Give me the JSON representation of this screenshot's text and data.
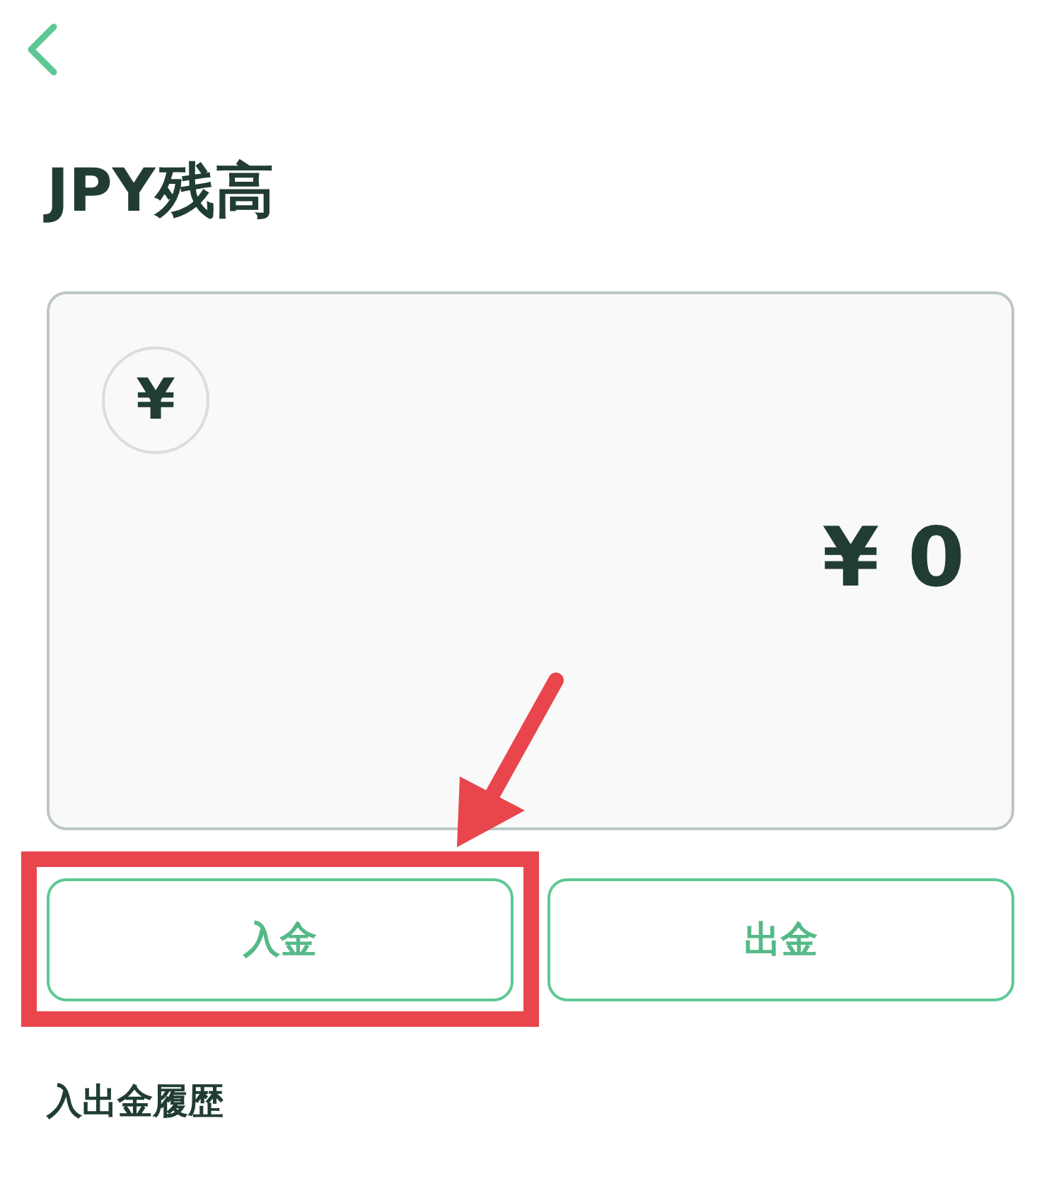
{
  "header": {
    "title": "JPY残高"
  },
  "balance_card": {
    "currency_symbol": "¥",
    "amount": "¥ 0"
  },
  "actions": [
    {
      "label": "入金",
      "highlighted": true
    },
    {
      "label": "出金",
      "highlighted": false
    }
  ],
  "history": {
    "title": "入出金履歴"
  }
}
